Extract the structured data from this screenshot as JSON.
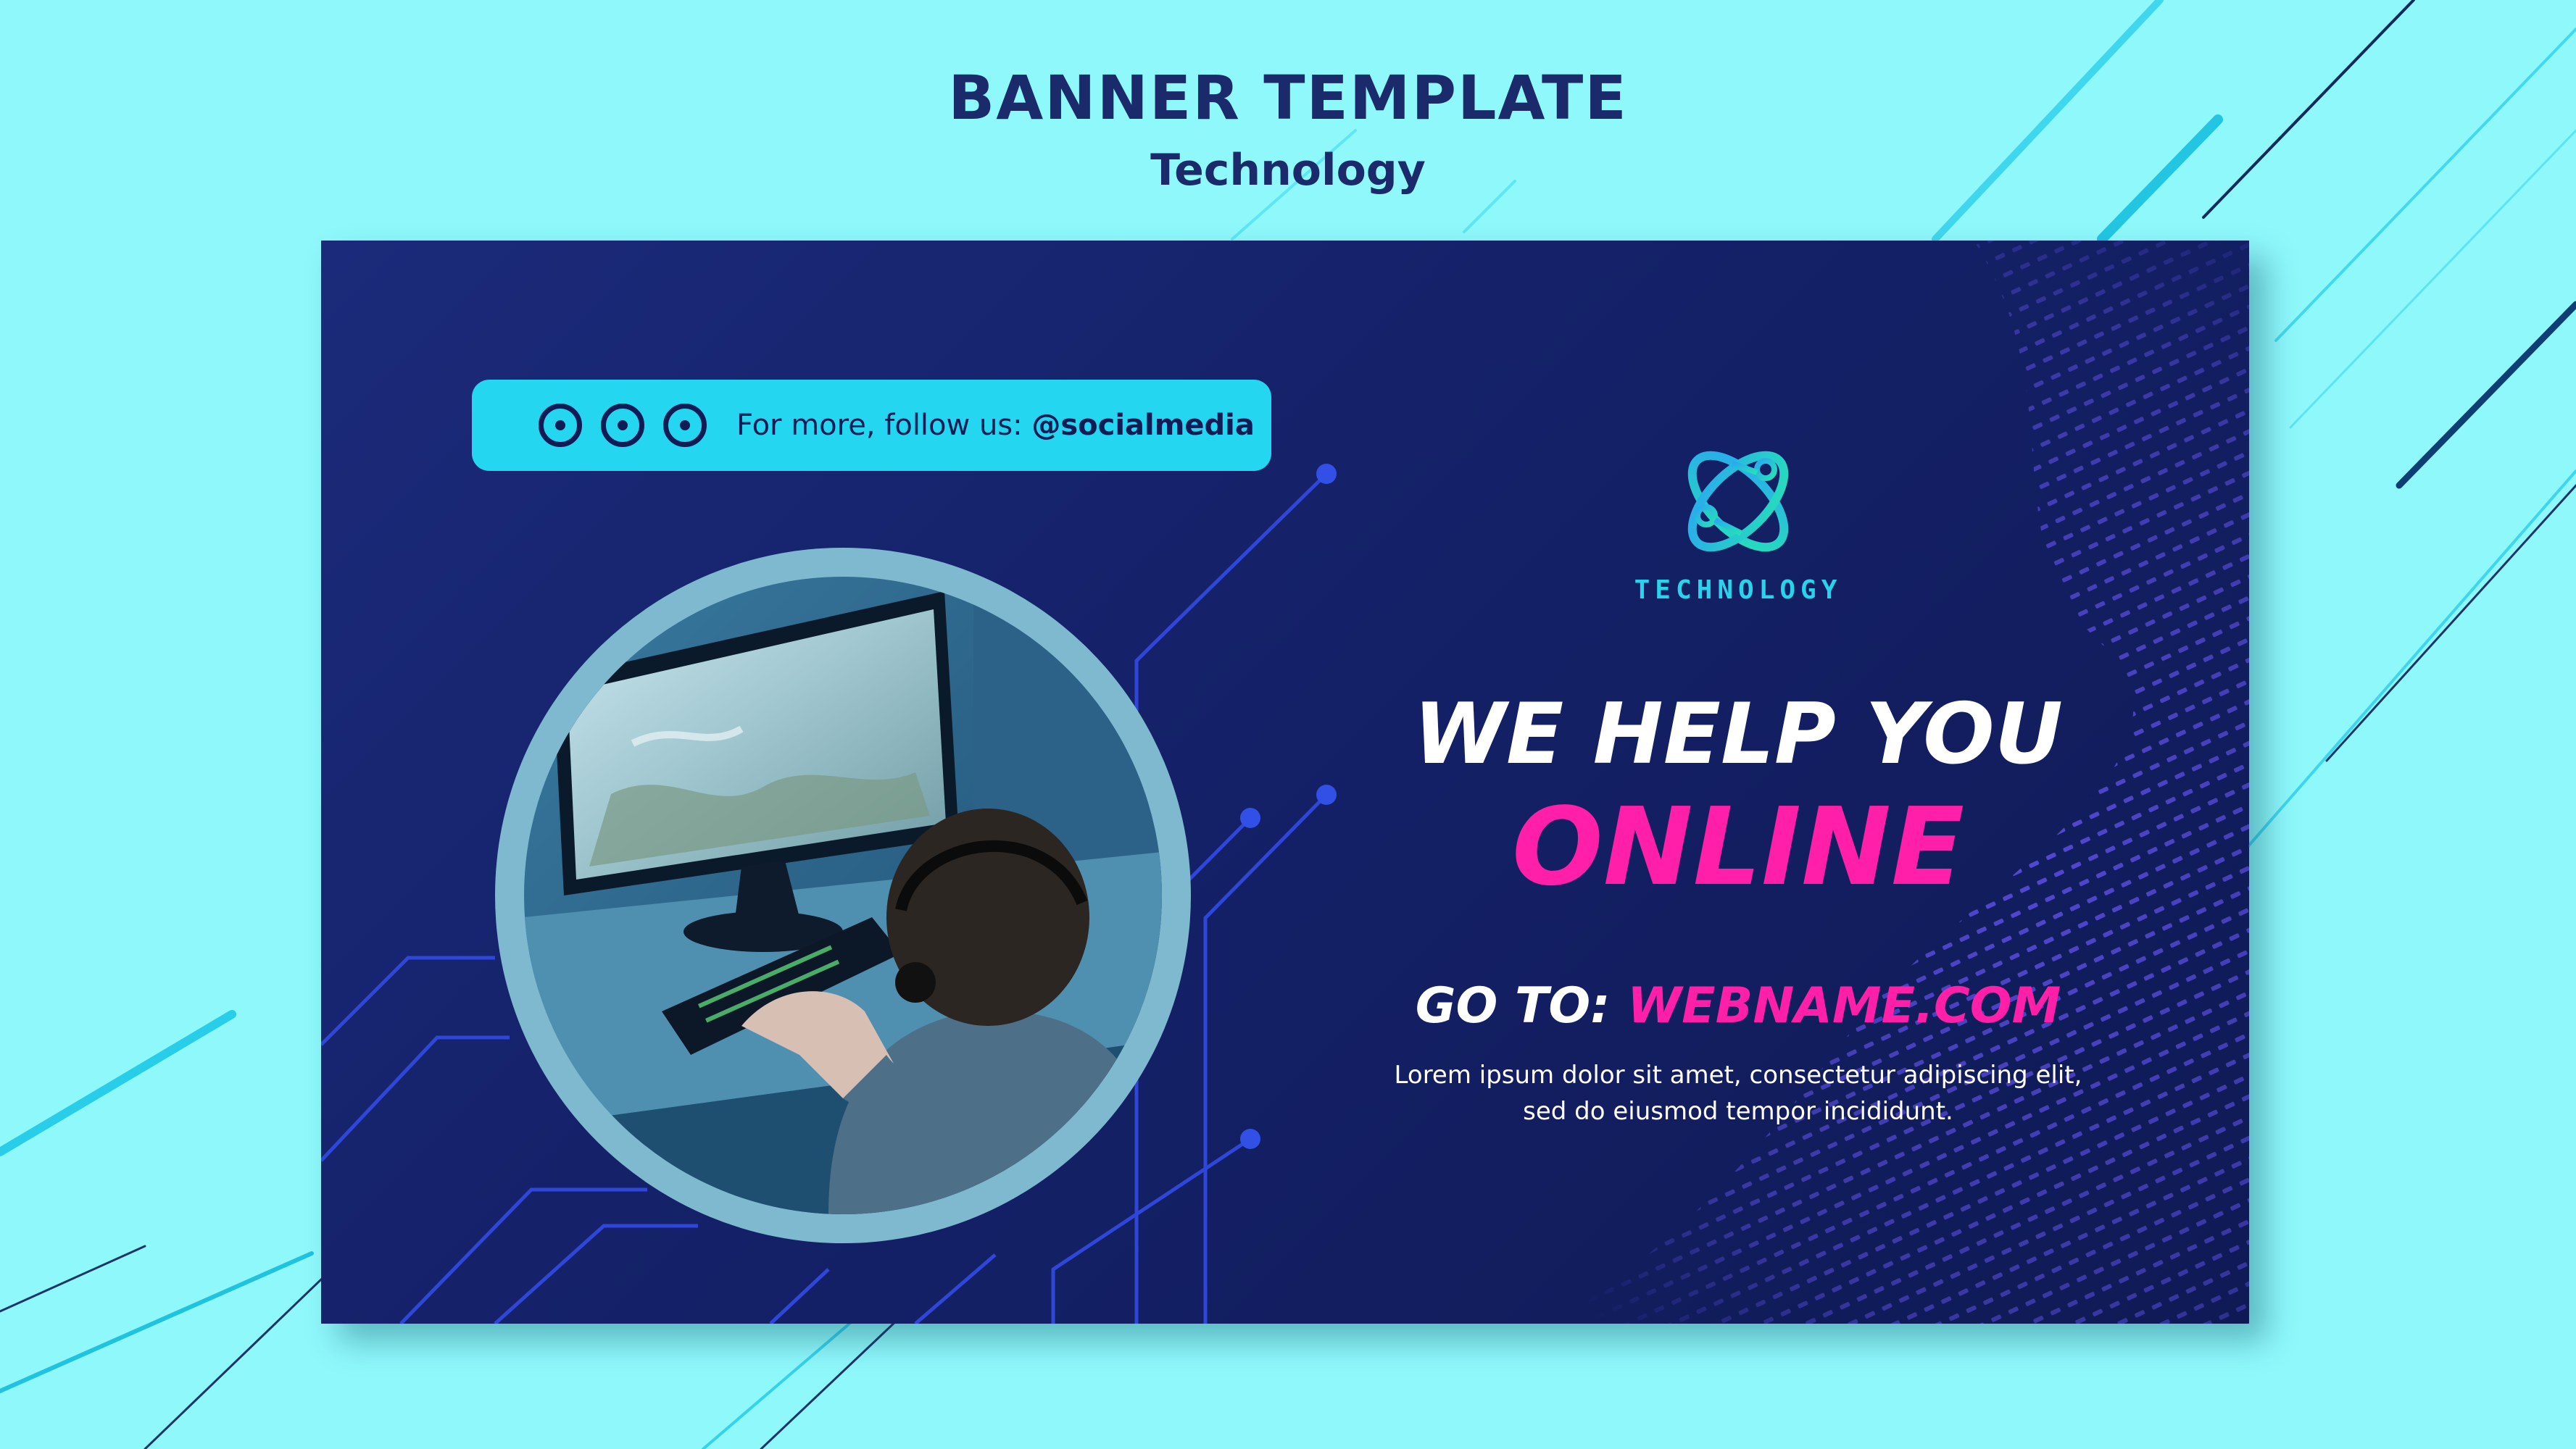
{
  "page": {
    "title": "BANNER TEMPLATE",
    "subtitle": "Technology"
  },
  "banner": {
    "social": {
      "icons": [
        "instagram-icon",
        "facebook-icon",
        "twitter-icon"
      ],
      "text": "For more, follow us:",
      "handle": "@socialmedia"
    },
    "photo": {
      "subject": "person-gaming-at-computer"
    },
    "logo": {
      "icon": "technology-atom-icon",
      "text": "TECHNOLOGY"
    },
    "headline": {
      "line1": "WE HELP YOU",
      "line2": "ONLINE"
    },
    "goto": {
      "label": "GO TO:",
      "url": "WEBNAME.COM"
    },
    "body": {
      "line1": "Lorem ipsum dolor sit amet, consectetur adipiscing elit,",
      "line2": "sed do eiusmod tempor incididunt."
    }
  },
  "colors": {
    "page_background": "#8ef8fb",
    "banner_background": "#15226a",
    "accent_cyan": "#25d6f0",
    "accent_pink": "#ff1fa8",
    "title_navy": "#1a2a6b"
  }
}
